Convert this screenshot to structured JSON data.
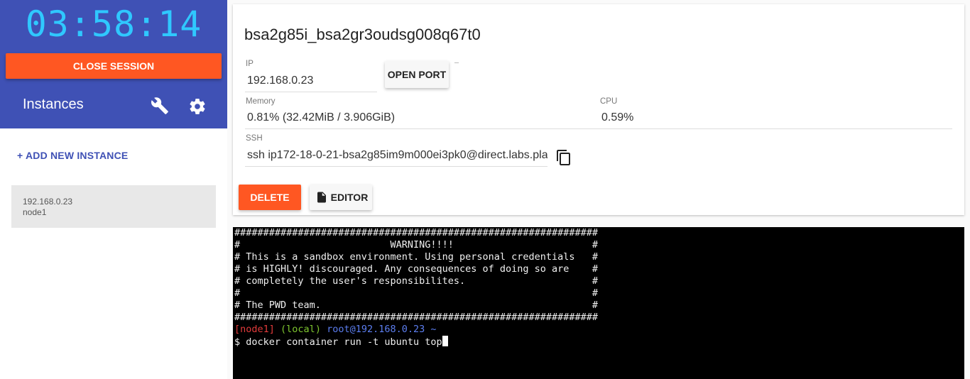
{
  "sidebar": {
    "timer": "03:58:14",
    "close_session_label": "CLOSE SESSION",
    "instances_title": "Instances",
    "add_instance_label": "+ ADD NEW INSTANCE",
    "instances": [
      {
        "ip": "192.168.0.23",
        "name": "node1"
      }
    ]
  },
  "details": {
    "title": "bsa2g85i_bsa2gr3oudsg008q67t0",
    "ip_label": "IP",
    "ip_value": "192.168.0.23",
    "open_port_label": "OPEN PORT",
    "memory_label": "Memory",
    "memory_value": "0.81% (32.42MiB / 3.906GiB)",
    "cpu_label": "CPU",
    "cpu_value": "0.59%",
    "ssh_label": "SSH",
    "ssh_value": "ssh ip172-18-0-21-bsa2g85im9m000ei3pk0@direct.labs.pla",
    "delete_label": "DELETE",
    "editor_label": "EDITOR"
  },
  "terminal": {
    "banner": [
      "###############################################################",
      "#                          WARNING!!!!                        #",
      "# This is a sandbox environment. Using personal credentials   #",
      "# is HIGHLY! discouraged. Any consequences of doing so are    #",
      "# completely the user's responsibilites.                      #",
      "#                                                             #",
      "# The PWD team.                                               #",
      "###############################################################"
    ],
    "prompt_node": "[node1]",
    "prompt_local": "(local)",
    "prompt_user": "root@192.168.0.23 ~",
    "command_prefix": "$ ",
    "command": "docker container run -t ubuntu top"
  },
  "colors": {
    "header_bg": "#3f51b5",
    "accent": "#ff5722",
    "timer": "#2fc8ff",
    "prompt_node": "#e23b3b",
    "prompt_local": "#7ec62f",
    "prompt_user": "#5c7ef0"
  }
}
